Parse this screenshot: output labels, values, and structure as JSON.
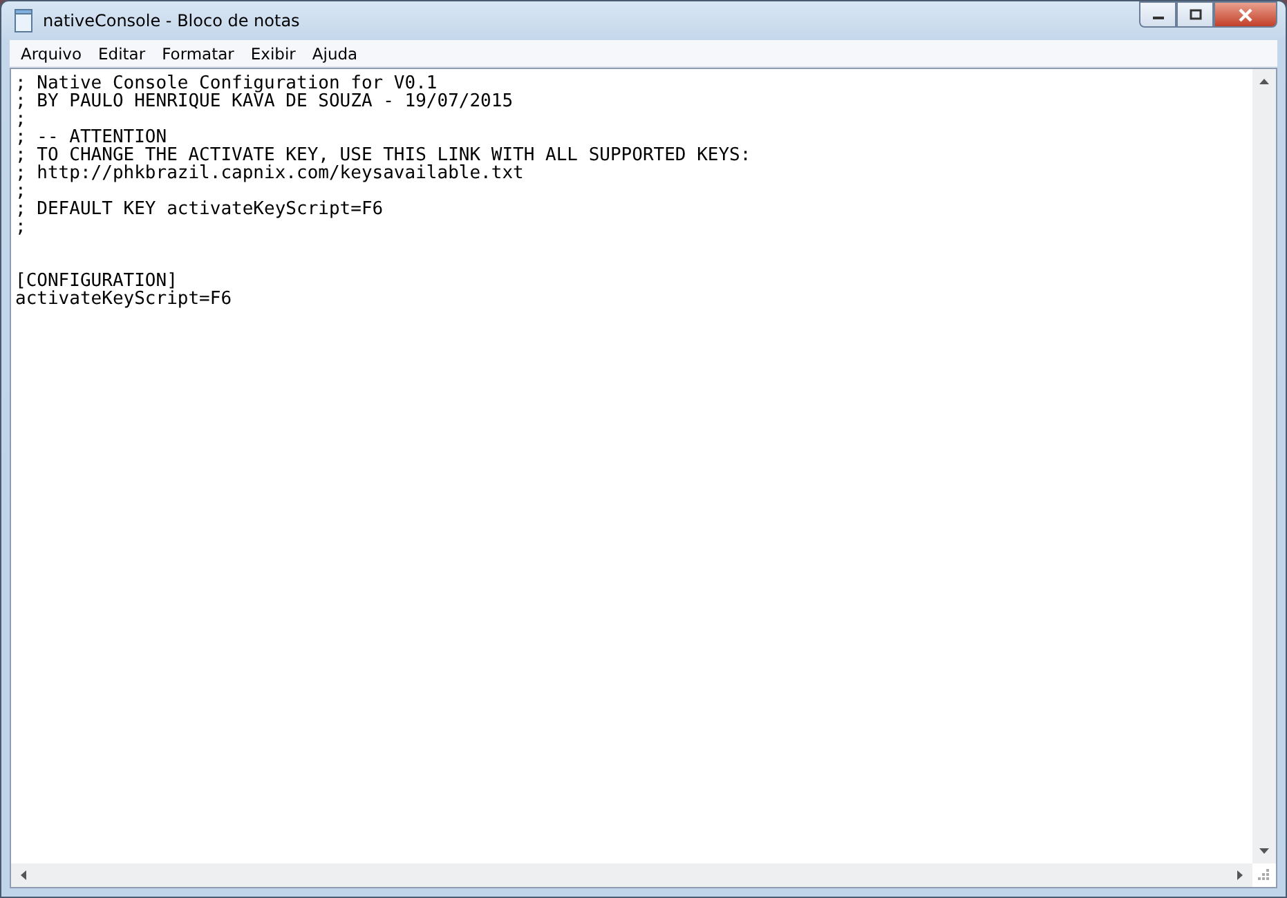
{
  "window": {
    "title": "nativeConsole - Bloco de notas"
  },
  "menu": [
    {
      "label": "Arquivo"
    },
    {
      "label": "Editar"
    },
    {
      "label": "Formatar"
    },
    {
      "label": "Exibir"
    },
    {
      "label": "Ajuda"
    }
  ],
  "document": {
    "lines": [
      {
        "kind": "text",
        "text": "; Native Console Configuration for V0.1"
      },
      {
        "kind": "text",
        "text": "; BY PAULO HENRIQUE KAVA DE SOUZA - 19/07/2015"
      },
      {
        "kind": "text",
        "text": ";"
      },
      {
        "kind": "text",
        "text": "; -- ATTENTION"
      },
      {
        "kind": "text",
        "text": "; TO CHANGE THE ACTIVATE KEY, USE THIS LINK WITH ALL SUPPORTED KEYS:"
      },
      {
        "kind": "text",
        "text": "; http://phkbrazil.capnix.com/keysavailable.txt"
      },
      {
        "kind": "text",
        "text": ";"
      },
      {
        "kind": "text",
        "text": "; DEFAULT KEY activateKeyScript=F6"
      },
      {
        "kind": "text",
        "text": ";"
      },
      {
        "kind": "blank"
      },
      {
        "kind": "blank"
      },
      {
        "kind": "text",
        "text": "[CONFIGURATION]"
      },
      {
        "kind": "text",
        "text": "activateKeyScript=F6"
      }
    ]
  }
}
